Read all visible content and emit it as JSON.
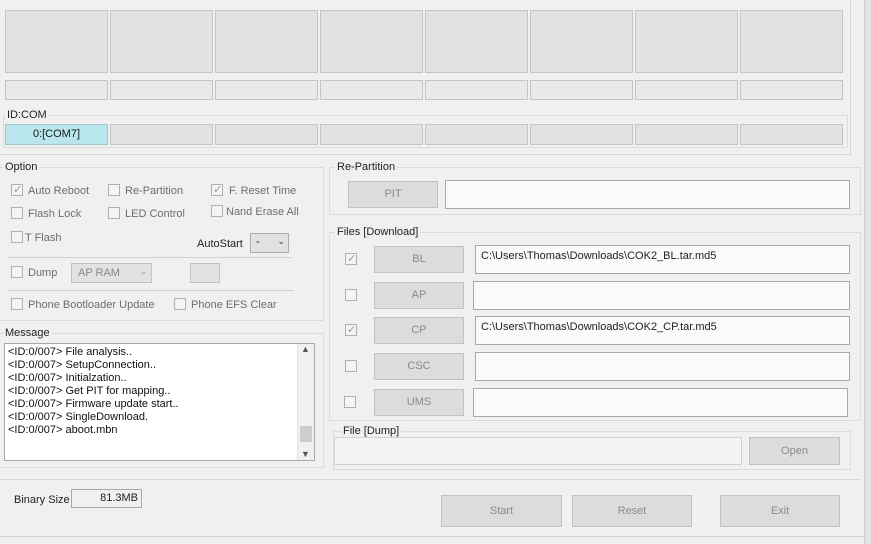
{
  "id_com_label": "ID:COM",
  "com_ports": [
    "0:[COM7]",
    "",
    "",
    "",
    "",
    "",
    "",
    ""
  ],
  "option": {
    "title": "Option",
    "auto_reboot": {
      "label": "Auto Reboot",
      "checked": true
    },
    "re_partition": {
      "label": "Re-Partition",
      "checked": false
    },
    "f_reset_time": {
      "label": "F. Reset Time",
      "checked": true
    },
    "flash_lock": {
      "label": "Flash Lock",
      "checked": false
    },
    "led_control": {
      "label": "LED Control",
      "checked": false
    },
    "nand_erase_all": {
      "label": "Nand Erase All",
      "checked": false
    },
    "t_flash": {
      "label": "T Flash",
      "checked": false
    },
    "autostart_label": "AutoStart",
    "autostart_value": "-",
    "dump": {
      "label": "Dump",
      "checked": false
    },
    "dump_target": "AP RAM",
    "phone_bootloader_update": {
      "label": "Phone Bootloader Update",
      "checked": false
    },
    "phone_efs_clear": {
      "label": "Phone EFS Clear",
      "checked": false
    }
  },
  "repartition": {
    "title": "Re-Partition",
    "pit_button": "PIT",
    "pit_path": ""
  },
  "files": {
    "title": "Files [Download]",
    "rows": [
      {
        "button": "BL",
        "checked": true,
        "path": "C:\\Users\\Thomas\\Downloads\\COK2_BL.tar.md5"
      },
      {
        "button": "AP",
        "checked": false,
        "path": ""
      },
      {
        "button": "CP",
        "checked": true,
        "path": "C:\\Users\\Thomas\\Downloads\\COK2_CP.tar.md5"
      },
      {
        "button": "CSC",
        "checked": false,
        "path": ""
      },
      {
        "button": "UMS",
        "checked": false,
        "path": ""
      }
    ]
  },
  "file_dump": {
    "title": "File [Dump]",
    "path": "",
    "open_button": "Open"
  },
  "message": {
    "title": "Message",
    "lines": [
      "<ID:0/007> File analysis..",
      "<ID:0/007> SetupConnection..",
      "<ID:0/007> Initialzation..",
      "<ID:0/007> Get PIT for mapping..",
      "<ID:0/007> Firmware update start..",
      "<ID:0/007> SingleDownload.",
      "<ID:0/007> aboot.mbn"
    ]
  },
  "binary_size": {
    "label": "Binary Size",
    "value": "81.3MB"
  },
  "actions": {
    "start": "Start",
    "reset": "Reset",
    "exit": "Exit"
  }
}
